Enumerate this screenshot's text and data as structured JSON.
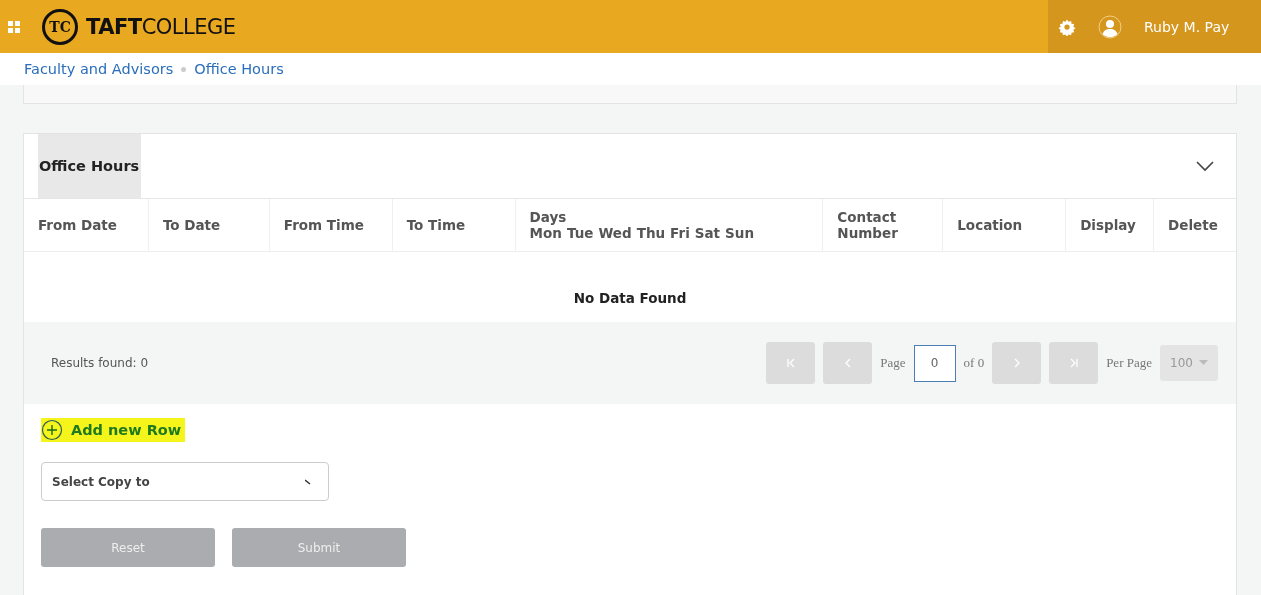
{
  "header": {
    "logo_monogram": "TC",
    "brand": "**TAFT**COLLEGE",
    "user_name": "Ruby M. Pay"
  },
  "breadcrumb": [
    "Faculty and Advisors",
    "Office Hours"
  ],
  "panel": {
    "title": "Office Hours",
    "expanded": true,
    "columns": [
      {
        "label": "From Date"
      },
      {
        "label": "To Date"
      },
      {
        "label": "From Time"
      },
      {
        "label": "To Time"
      },
      {
        "label": "Days",
        "days": [
          "Mon",
          "Tue",
          "Wed",
          "Thu",
          "Fri",
          "Sat",
          "Sun"
        ]
      },
      {
        "label": "Contact Number"
      },
      {
        "label": "Location"
      },
      {
        "label": "Display"
      },
      {
        "label": "Delete"
      }
    ],
    "empty_message": "No Data Found",
    "results": "Results found: 0",
    "pager": {
      "disabled": true,
      "page_label": "Page",
      "page": "0",
      "of": "of 0",
      "per_page_label": "Per Page",
      "per_page": "100"
    }
  },
  "add_row": {
    "label": "Add new Row",
    "highlighted": true
  },
  "copy_select": {
    "placeholder": "Select Copy to"
  },
  "buttons": [
    {
      "label": "Reset",
      "disabled": true
    },
    {
      "label": "Submit",
      "disabled": true
    }
  ]
}
